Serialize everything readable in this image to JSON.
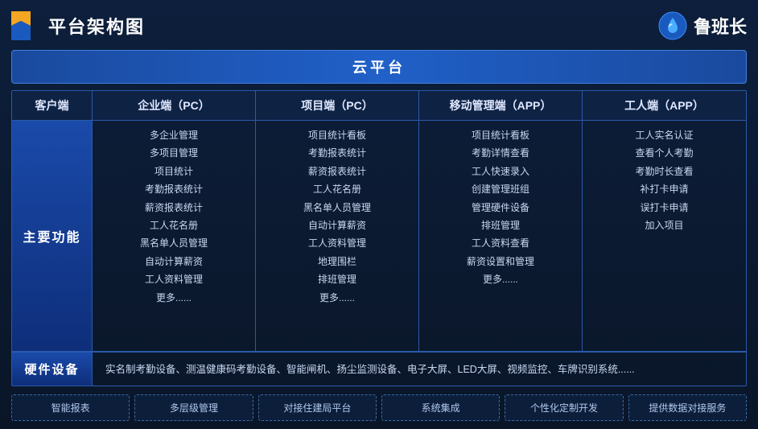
{
  "header": {
    "title": "平台架构图",
    "brand_name": "鲁班长"
  },
  "cloud_banner": "云平台",
  "columns": {
    "label": "客户端",
    "items": [
      {
        "id": "enterprise",
        "label": "企业端（PC）"
      },
      {
        "id": "project",
        "label": "项目端（PC）"
      },
      {
        "id": "mobile",
        "label": "移动管理端（APP）"
      },
      {
        "id": "worker",
        "label": "工人端（APP）"
      }
    ]
  },
  "main_row": {
    "label": "主要功能",
    "enterprise_features": [
      "多企业管理",
      "多项目管理",
      "项目统计",
      "考勤报表统计",
      "薪资报表统计",
      "工人花名册",
      "黑名单人员管理",
      "自动计算薪资",
      "工人资料管理",
      "更多......"
    ],
    "project_features": [
      "项目统计看板",
      "考勤报表统计",
      "薪资报表统计",
      "工人花名册",
      "黑名单人员管理",
      "自动计算薪资",
      "工人资料管理",
      "地理围栏",
      "排班管理",
      "更多......"
    ],
    "mobile_features": [
      "项目统计看板",
      "考勤详情查看",
      "工人快速录入",
      "创建管理班组",
      "管理硬件设备",
      "排班管理",
      "工人资料查看",
      "薪资设置和管理",
      "更多......"
    ],
    "worker_features": [
      "工人实名认证",
      "查看个人考勤",
      "考勤时长查看",
      "补打卡申请",
      "误打卡申请",
      "加入项目"
    ]
  },
  "hardware": {
    "label": "硬件设备",
    "content": "实名制考勤设备、测温健康码考勤设备、智能闸机、扬尘监测设备、电子大屏、LED大屏、视频监控、车牌识别系统......"
  },
  "services": [
    "智能报表",
    "多层级管理",
    "对接住建局平台",
    "系统集成",
    "个性化定制开发",
    "提供数据对接服务"
  ]
}
